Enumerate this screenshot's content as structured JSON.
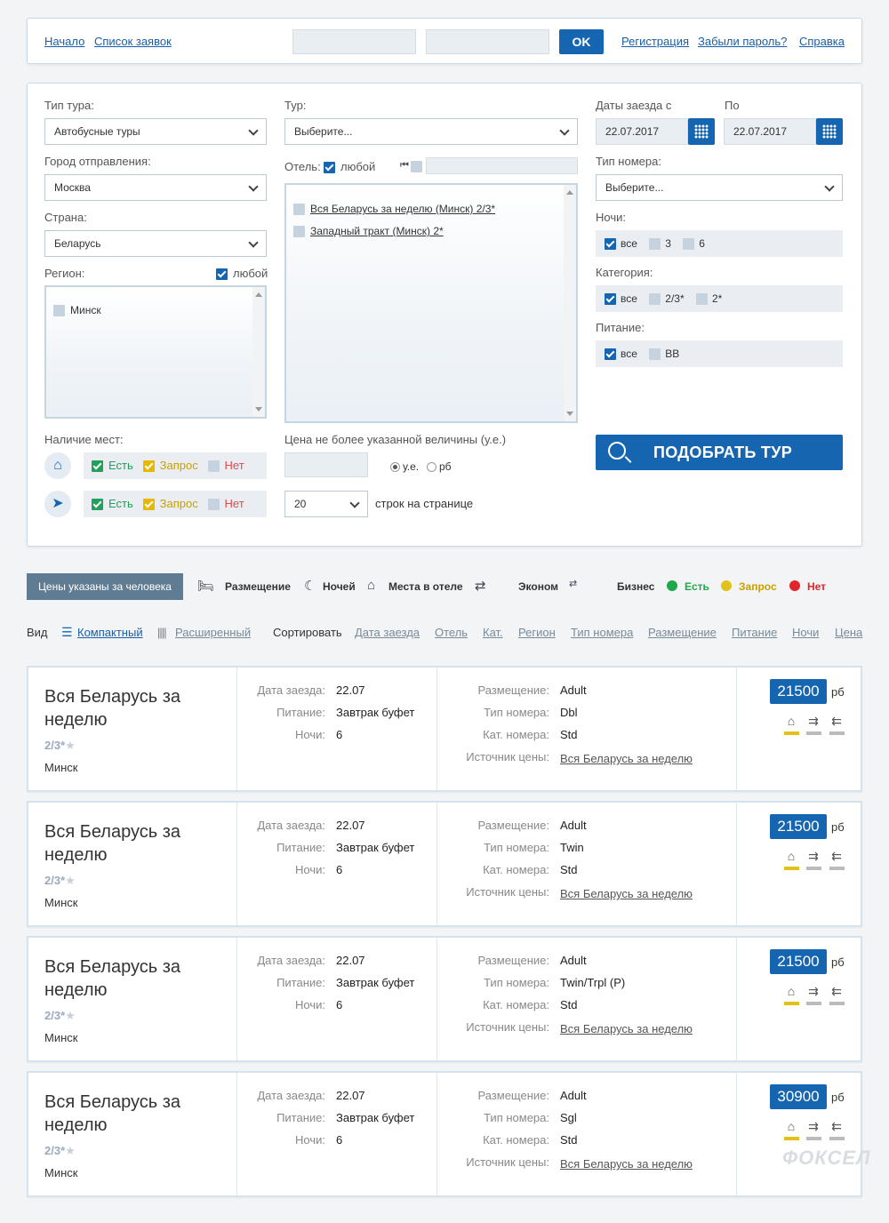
{
  "topbar": {
    "start": "Начало",
    "requests": "Список заявок",
    "ok": "OK",
    "register": "Регистрация",
    "forgot": "Забыли пароль?",
    "help": "Справка"
  },
  "search": {
    "tour_type_label": "Тип тура:",
    "tour_type_value": "Автобусные туры",
    "departure_label": "Город отправления:",
    "departure_value": "Москва",
    "country_label": "Страна:",
    "country_value": "Беларусь",
    "region_label": "Регион:",
    "region_any": "любой",
    "regions": [
      "Минск"
    ],
    "tour_label": "Тур:",
    "tour_value": "Выберите...",
    "hotel_label": "Отель:",
    "hotel_any": "любой",
    "hotels": [
      "Вся Беларусь за неделю (Минск) 2/3*",
      "Западный тракт (Минск) 2*"
    ],
    "dates_from_label": "Даты заезда с",
    "dates_to_label": "По",
    "date_from": "22.07.2017",
    "date_to": "22.07.2017",
    "room_type_label": "Тип номера:",
    "room_type_value": "Выберите...",
    "nights_label": "Ночи:",
    "nights_all": "все",
    "nights_opts": [
      "3",
      "6"
    ],
    "category_label": "Категория:",
    "category_all": "все",
    "category_opts": [
      "2/3*",
      "2*"
    ],
    "meal_label": "Питание:",
    "meal_all": "все",
    "meal_opts": [
      "BB"
    ],
    "availability_label": "Наличие мест:",
    "avail_yes": "Есть",
    "avail_request": "Запрос",
    "avail_no": "Нет",
    "price_label": "Цена не более указанной величины (у.е.)",
    "currency_ue": "у.е.",
    "currency_rb": "рб",
    "rows_value": "20",
    "rows_label": "строк на странице",
    "submit": "ПОДОБРАТЬ ТУР"
  },
  "legend": {
    "per_person": "Цены указаны за человека",
    "placement": "Размещение",
    "nights": "Ночей",
    "hotel_places": "Места в отеле",
    "economy": "Эконом",
    "business": "Бизнес",
    "yes": "Есть",
    "request": "Запрос",
    "no": "Нет",
    "colors": {
      "yes": "#1fa84a",
      "request": "#e2c21a",
      "no": "#e0262c"
    }
  },
  "sortbar": {
    "view_label": "Вид",
    "compact": "Компактный",
    "extended": "Расширенный",
    "sort_label": "Сортировать",
    "sort_options": [
      "Дата заезда",
      "Отель",
      "Кат.",
      "Регион",
      "Тип номера",
      "Размещение",
      "Питание",
      "Ночи",
      "Цена"
    ]
  },
  "result_labels": {
    "checkin": "Дата заезда:",
    "meal": "Питание:",
    "nights": "Ночи:",
    "placement": "Размещение:",
    "room_type": "Тип номера:",
    "room_cat": "Кат. номера:",
    "price_source": "Источник цены:",
    "currency": "рб"
  },
  "results": [
    {
      "title": "Вся Беларусь за неделю",
      "category": "2/3*",
      "city": "Минск",
      "checkin": "22.07",
      "meal": "Завтрак буфет",
      "nights": "6",
      "placement": "Adult",
      "room_type": "Dbl",
      "room_cat": "Std",
      "source": "Вся Беларусь за неделю",
      "price": "21500"
    },
    {
      "title": "Вся Беларусь за неделю",
      "category": "2/3*",
      "city": "Минск",
      "checkin": "22.07",
      "meal": "Завтрак буфет",
      "nights": "6",
      "placement": "Adult",
      "room_type": "Twin",
      "room_cat": "Std",
      "source": "Вся Беларусь за неделю",
      "price": "21500"
    },
    {
      "title": "Вся Беларусь за неделю",
      "category": "2/3*",
      "city": "Минск",
      "checkin": "22.07",
      "meal": "Завтрак буфет",
      "nights": "6",
      "placement": "Adult",
      "room_type": "Twin/Trpl (P)",
      "room_cat": "Std",
      "source": "Вся Беларусь за неделю",
      "price": "21500"
    },
    {
      "title": "Вся Беларусь за неделю",
      "category": "2/3*",
      "city": "Минск",
      "checkin": "22.07",
      "meal": "Завтрак буфет",
      "nights": "6",
      "placement": "Adult",
      "room_type": "Sgl",
      "room_cat": "Std",
      "source": "Вся Беларусь за неделю",
      "price": "30900"
    }
  ],
  "watermark": "ФОКСЕЛ"
}
